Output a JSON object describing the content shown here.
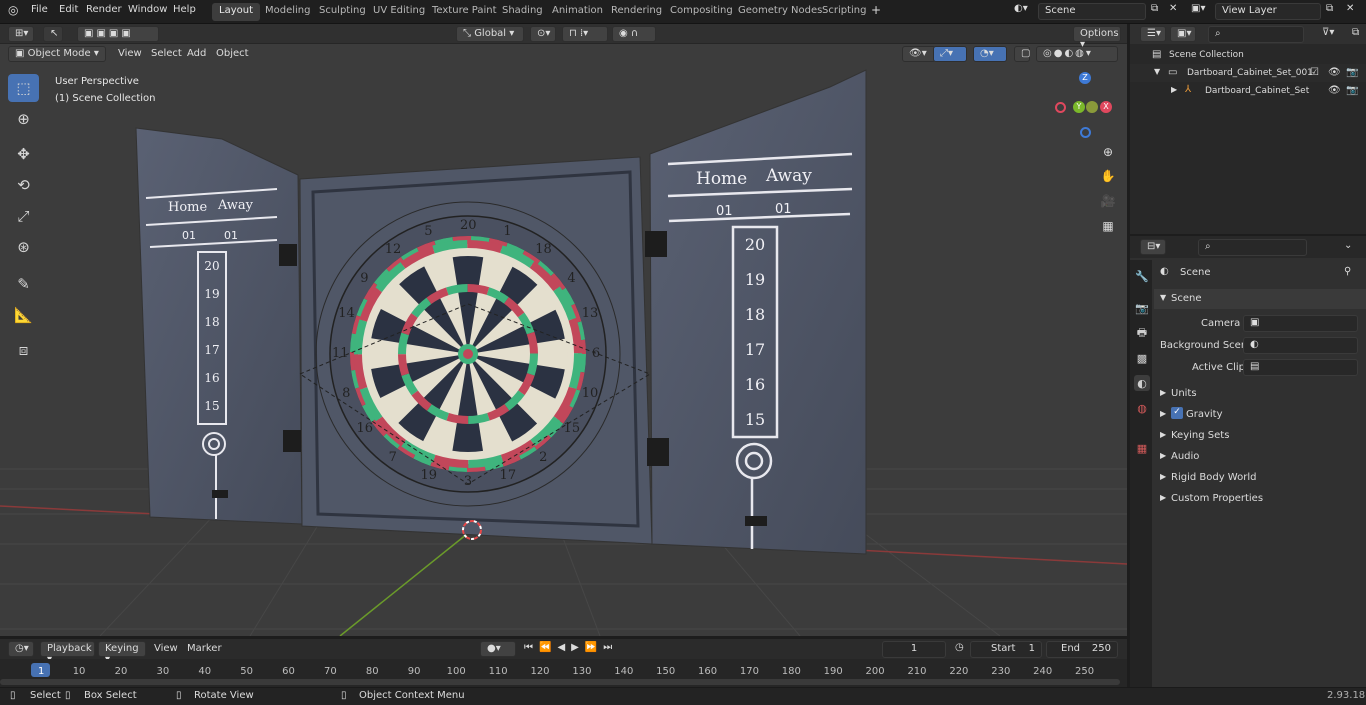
{
  "topbar": {
    "menu": [
      "File",
      "Edit",
      "Render",
      "Window",
      "Help"
    ],
    "workspaces": [
      "Layout",
      "Modeling",
      "Sculpting",
      "UV Editing",
      "Texture Paint",
      "Shading",
      "Animation",
      "Rendering",
      "Compositing",
      "Geometry Nodes",
      "Scripting"
    ],
    "scene": "Scene",
    "view_layer": "View Layer"
  },
  "viewport_header": {
    "mode": "Object Mode",
    "menus": [
      "View",
      "Select",
      "Add",
      "Object"
    ],
    "orientation": "Global",
    "options": "Options"
  },
  "overlay": {
    "perspective": "User Perspective",
    "collection": "(1) Scene Collection"
  },
  "axes": {
    "x": "X",
    "y": "Y",
    "z": "Z"
  },
  "scoreboard": {
    "home": "Home",
    "away": "Away",
    "scores": [
      "01",
      "01"
    ],
    "numbers": [
      "20",
      "19",
      "18",
      "17",
      "16",
      "15"
    ]
  },
  "dartboard": {
    "numbers": [
      "20",
      "1",
      "18",
      "4",
      "13",
      "6",
      "10",
      "15",
      "2",
      "17",
      "3",
      "19",
      "7",
      "16",
      "8",
      "11",
      "14",
      "9",
      "12",
      "5"
    ]
  },
  "outliner": {
    "root": "Scene Collection",
    "collection": "Dartboard_Cabinet_Set_001",
    "object": "Dartboard_Cabinet_Set"
  },
  "properties": {
    "context": "Scene",
    "section": "Scene",
    "camera_label": "Camera",
    "bg_label": "Background Scene",
    "clip_label": "Active Clip",
    "panels": [
      "Units",
      "Gravity",
      "Keying Sets",
      "Audio",
      "Rigid Body World",
      "Custom Properties"
    ]
  },
  "timeline": {
    "menus": [
      "Playback",
      "Keying",
      "View",
      "Marker"
    ],
    "current_frame": "1",
    "start_label": "Start",
    "start": "1",
    "end_label": "End",
    "end": "250",
    "ticks": [
      "1",
      "10",
      "20",
      "30",
      "40",
      "50",
      "60",
      "70",
      "80",
      "90",
      "100",
      "110",
      "120",
      "130",
      "140",
      "150",
      "160",
      "170",
      "180",
      "190",
      "200",
      "210",
      "220",
      "230",
      "240",
      "250"
    ]
  },
  "status": {
    "select": "Select",
    "box_select": "Box Select",
    "rotate": "Rotate View",
    "context_menu": "Object Context Menu",
    "version": "2.93.18"
  },
  "colors": {
    "accent": "#4772b3",
    "cabinet": "#4e5566",
    "green": "#3fb47d",
    "red": "#c2475a",
    "cream": "#e4dfce",
    "dark": "#2b3242"
  }
}
